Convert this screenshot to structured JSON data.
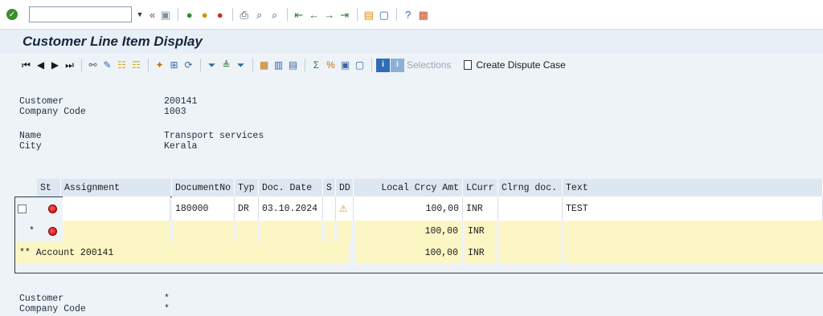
{
  "system_toolbar": {
    "command_field_value": "",
    "icons": [
      "check-icon",
      "back-double-icon",
      "save-icon",
      "back-icon",
      "exit-icon",
      "cancel-icon",
      "print-icon",
      "find-icon",
      "find-next-icon",
      "first-page-icon",
      "prev-page-icon",
      "next-page-icon",
      "last-page-icon",
      "new-session-icon",
      "shortcut-icon",
      "help-icon",
      "customize-icon"
    ]
  },
  "title": "Customer Line Item Display",
  "app_toolbar": {
    "selections_label": "Selections",
    "create_dispute_label": "Create Dispute Case"
  },
  "header": {
    "customer_label": "Customer",
    "customer_value": "200141",
    "company_code_label": "Company Code",
    "company_code_value": "1003",
    "name_label": "Name",
    "name_value": "Transport services",
    "city_label": "City",
    "city_value": "Kerala"
  },
  "table": {
    "columns": {
      "st": "St",
      "assignment": "Assignment",
      "document_no": "DocumentNo",
      "typ": "Typ",
      "doc_date": "Doc. Date",
      "s": "S",
      "dd": "DD",
      "local_amt": "Local Crcy Amt",
      "lcurr": "LCurr",
      "clrng_doc": "Clrng doc.",
      "text": "Text"
    },
    "row1": {
      "assignment": "",
      "document_no": "180000",
      "typ": "DR",
      "doc_date": "03.10.2024",
      "s": "",
      "local_amt": "100,00",
      "lcurr": "INR",
      "clrng_doc": "",
      "text": "TEST"
    },
    "subtotal": {
      "marker": "*",
      "local_amt": "100,00",
      "lcurr": "INR"
    },
    "account_total": {
      "label": "** Account 200141",
      "local_amt": "100,00",
      "lcurr": "INR"
    }
  },
  "footer": {
    "customer_label": "Customer",
    "customer_value": "*",
    "company_code_label": "Company Code",
    "company_code_value": "*"
  },
  "colors": {
    "status_red": "#c30000",
    "total_row_bg": "#fbf6c4",
    "header_row_bg": "#dde7f1"
  }
}
